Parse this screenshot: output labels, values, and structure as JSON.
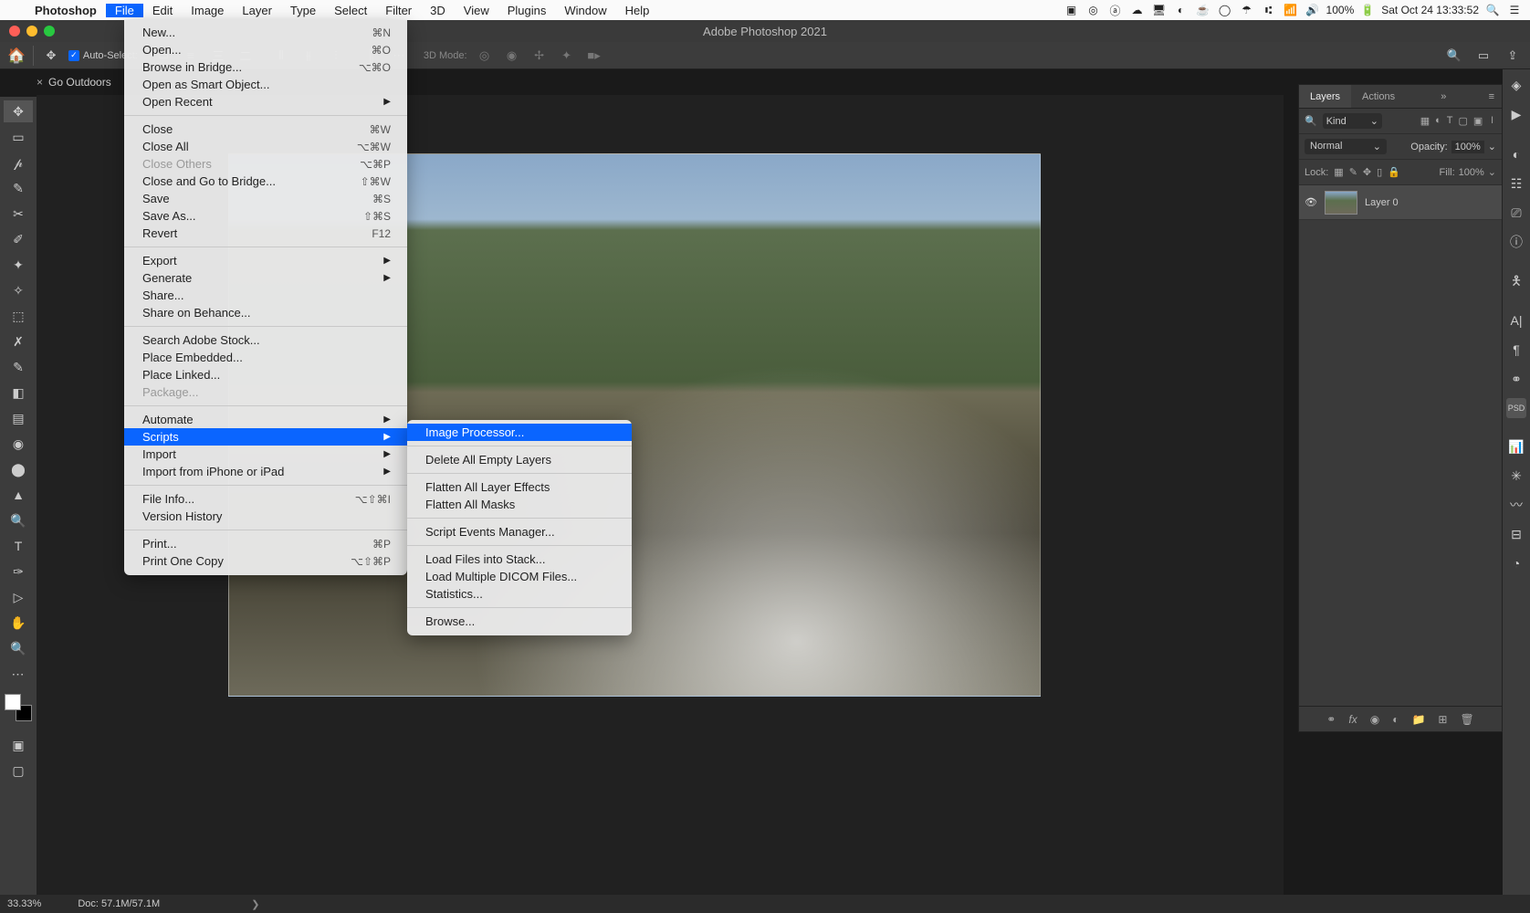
{
  "menubar": {
    "app": "Photoshop",
    "items": [
      "File",
      "Edit",
      "Image",
      "Layer",
      "Type",
      "Select",
      "Filter",
      "3D",
      "View",
      "Plugins",
      "Window",
      "Help"
    ],
    "open_index": 0,
    "battery": "100%",
    "datetime": "Sat Oct 24  13:33:52"
  },
  "window_title": "Adobe Photoshop 2021",
  "options_bar": {
    "auto_label": "Auto-Select:",
    "mode3d_label": "3D Mode:"
  },
  "doc_tab": "Go Outdoors",
  "file_menu": [
    {
      "t": "New...",
      "sc": "⌘N"
    },
    {
      "t": "Open...",
      "sc": "⌘O"
    },
    {
      "t": "Browse in Bridge...",
      "sc": "⌥⌘O"
    },
    {
      "t": "Open as Smart Object..."
    },
    {
      "t": "Open Recent",
      "sub": true
    },
    {
      "hr": true
    },
    {
      "t": "Close",
      "sc": "⌘W"
    },
    {
      "t": "Close All",
      "sc": "⌥⌘W"
    },
    {
      "t": "Close Others",
      "sc": "⌥⌘P",
      "dis": true
    },
    {
      "t": "Close and Go to Bridge...",
      "sc": "⇧⌘W"
    },
    {
      "t": "Save",
      "sc": "⌘S"
    },
    {
      "t": "Save As...",
      "sc": "⇧⌘S"
    },
    {
      "t": "Revert",
      "sc": "F12"
    },
    {
      "hr": true
    },
    {
      "t": "Export",
      "sub": true
    },
    {
      "t": "Generate",
      "sub": true
    },
    {
      "t": "Share..."
    },
    {
      "t": "Share on Behance..."
    },
    {
      "hr": true
    },
    {
      "t": "Search Adobe Stock..."
    },
    {
      "t": "Place Embedded..."
    },
    {
      "t": "Place Linked..."
    },
    {
      "t": "Package...",
      "dis": true
    },
    {
      "hr": true
    },
    {
      "t": "Automate",
      "sub": true
    },
    {
      "t": "Scripts",
      "sub": true,
      "hl": true
    },
    {
      "t": "Import",
      "sub": true
    },
    {
      "t": "Import from iPhone or iPad",
      "sub": true
    },
    {
      "hr": true
    },
    {
      "t": "File Info...",
      "sc": "⌥⇧⌘I"
    },
    {
      "t": "Version History"
    },
    {
      "hr": true
    },
    {
      "t": "Print...",
      "sc": "⌘P"
    },
    {
      "t": "Print One Copy",
      "sc": "⌥⇧⌘P"
    }
  ],
  "scripts_menu": [
    {
      "t": "Image Processor...",
      "hl": true
    },
    {
      "hr": true
    },
    {
      "t": "Delete All Empty Layers"
    },
    {
      "hr": true
    },
    {
      "t": "Flatten All Layer Effects"
    },
    {
      "t": "Flatten All Masks"
    },
    {
      "hr": true
    },
    {
      "t": "Script Events Manager..."
    },
    {
      "hr": true
    },
    {
      "t": "Load Files into Stack..."
    },
    {
      "t": "Load Multiple DICOM Files..."
    },
    {
      "t": "Statistics..."
    },
    {
      "hr": true
    },
    {
      "t": "Browse..."
    }
  ],
  "layers_panel": {
    "tabs": [
      "Layers",
      "Actions"
    ],
    "kind_label": "Kind",
    "blend_mode": "Normal",
    "opacity_label": "Opacity:",
    "opacity_value": "100%",
    "lock_label": "Lock:",
    "fill_label": "Fill:",
    "fill_value": "100%",
    "layer_name": "Layer 0"
  },
  "status": {
    "zoom": "33.33%",
    "doc": "Doc: 57.1M/57.1M"
  }
}
